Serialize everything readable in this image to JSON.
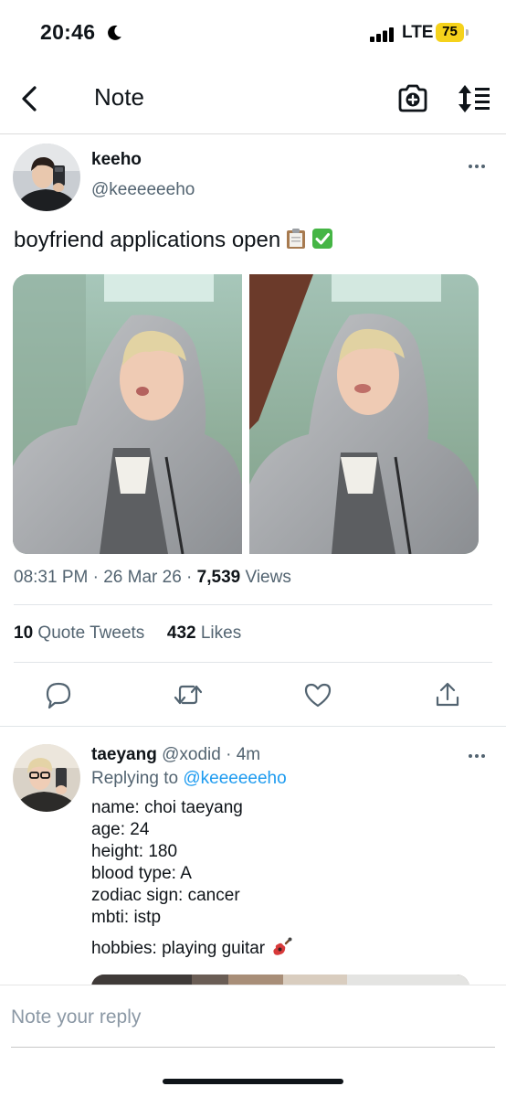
{
  "status_bar": {
    "time": "20:46",
    "network": "LTE",
    "battery": "75",
    "icons": [
      "moon-icon",
      "signal-icon",
      "battery-icon"
    ]
  },
  "nav": {
    "title": "Note",
    "icons": [
      "back-chevron-icon",
      "camera-plus-icon",
      "sort-icon"
    ]
  },
  "tweet": {
    "author_name": "keeho",
    "author_handle": "@keeeeeeho",
    "text": "boyfriend applications open",
    "emojis": [
      "clipboard-emoji",
      "check-mark-emoji"
    ],
    "time": "08:31 PM",
    "date": "26 Mar 26",
    "views_count": "7,539",
    "views_label": "Views",
    "quote_count": "10",
    "quote_label": "Quote Tweets",
    "likes_count": "432",
    "likes_label": "Likes",
    "actions": [
      "reply-icon",
      "retweet-icon",
      "like-icon",
      "share-icon"
    ]
  },
  "reply": {
    "name": "taeyang",
    "handle": "@xodid",
    "separator": "·",
    "time": "4m",
    "replying_prefix": "Replying to",
    "replying_to": "@keeeeeeho",
    "lines": [
      "name: choi taeyang",
      "age: 24",
      "height: 180",
      "blood type: A",
      "zodiac sign: cancer",
      "mbti: istp"
    ],
    "hobbies": "hobbies: playing guitar"
  },
  "compose": {
    "placeholder": "Note your reply"
  },
  "colors": {
    "link": "#1d9bf0",
    "secondary_text": "#536471",
    "battery": "#f5d21b"
  }
}
